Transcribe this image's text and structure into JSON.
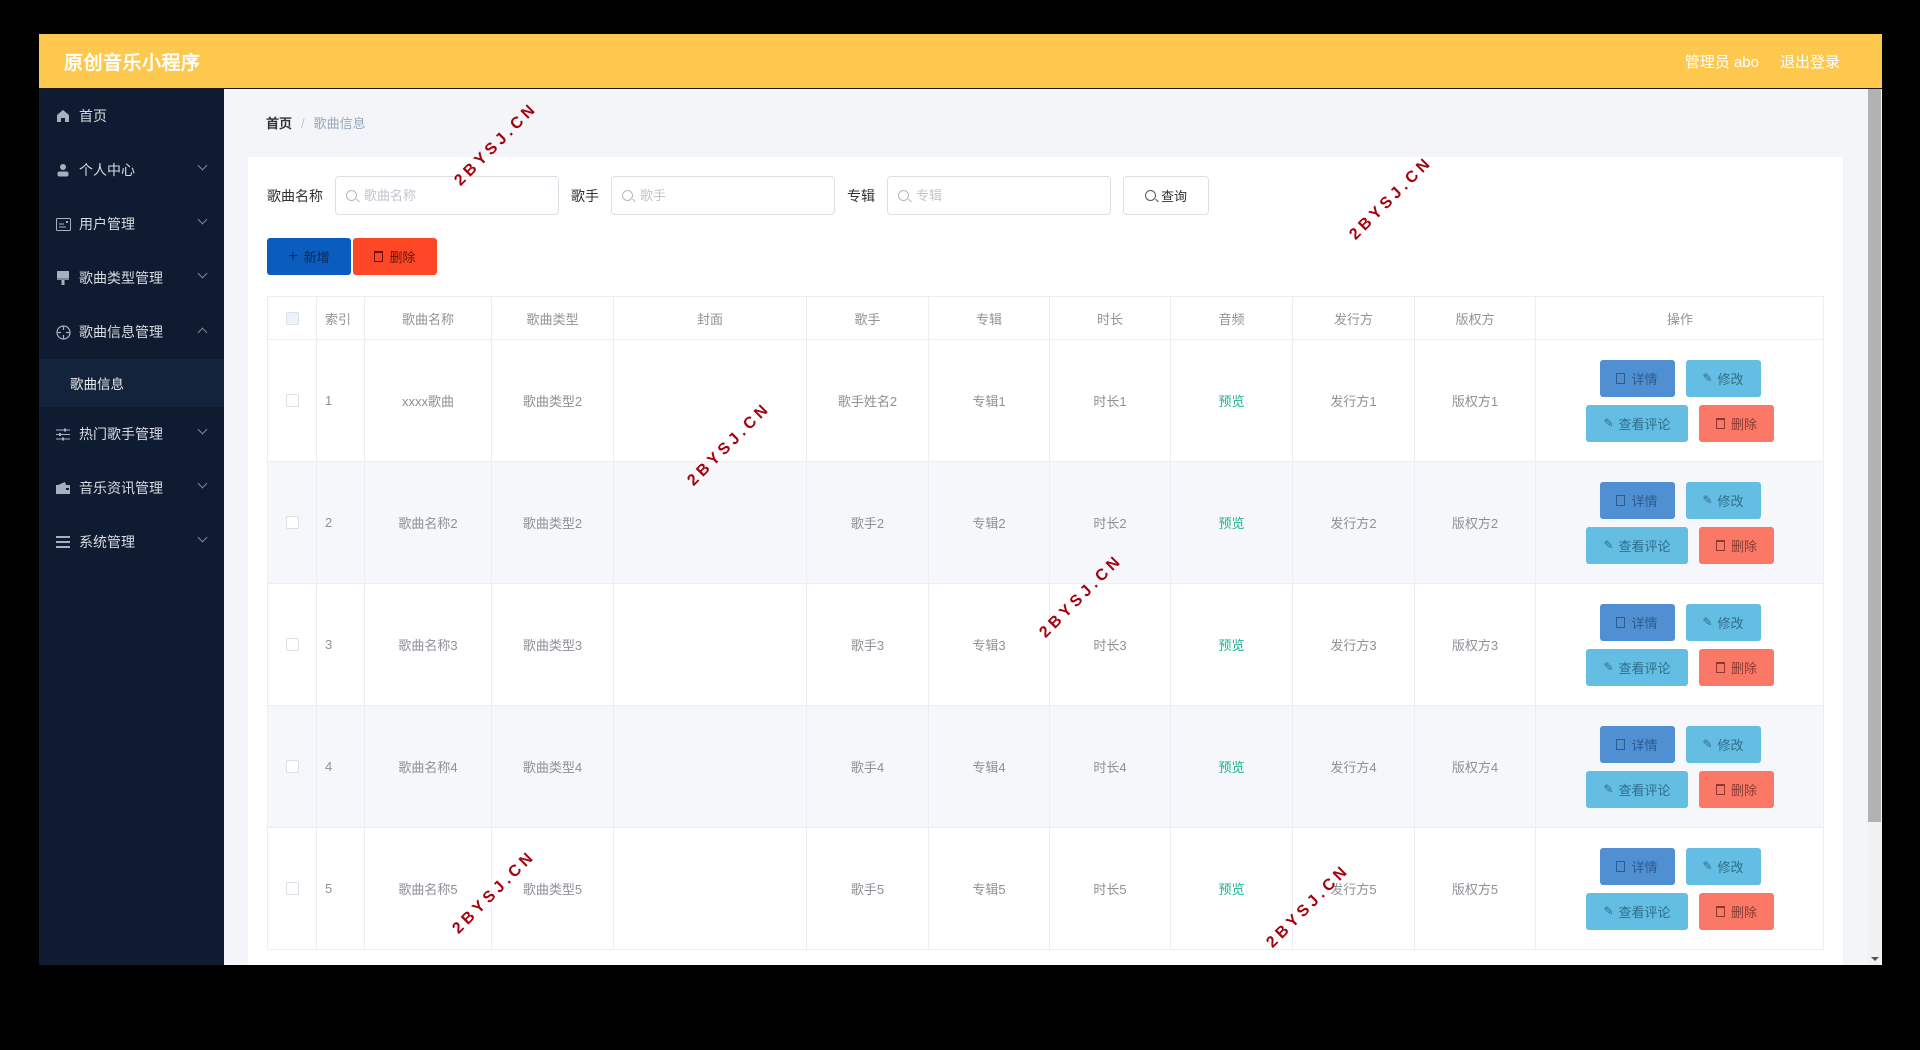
{
  "header": {
    "title": "原创音乐小程序",
    "user": "管理员 abo",
    "logout": "退出登录"
  },
  "sidebar": {
    "items": [
      {
        "label": "首页",
        "icon": "home-icon",
        "expandable": false
      },
      {
        "label": "个人中心",
        "icon": "user-icon",
        "expandable": true
      },
      {
        "label": "用户管理",
        "icon": "id-card-icon",
        "expandable": true
      },
      {
        "label": "歌曲类型管理",
        "icon": "brush-icon",
        "expandable": true
      },
      {
        "label": "歌曲信息管理",
        "icon": "target-icon",
        "expandable": true,
        "expanded": true
      },
      {
        "label": "热门歌手管理",
        "icon": "sliders-icon",
        "expandable": true
      },
      {
        "label": "音乐资讯管理",
        "icon": "wallet-icon",
        "expandable": true
      },
      {
        "label": "系统管理",
        "icon": "menu-icon",
        "expandable": true
      }
    ],
    "submenu_active": "歌曲信息"
  },
  "breadcrumb": {
    "home": "首页",
    "separator": "/",
    "current": "歌曲信息"
  },
  "search": {
    "fields": [
      {
        "label": "歌曲名称",
        "placeholder": "歌曲名称",
        "value": ""
      },
      {
        "label": "歌手",
        "placeholder": "歌手",
        "value": ""
      },
      {
        "label": "专辑",
        "placeholder": "专辑",
        "value": ""
      }
    ],
    "query_button": "查询"
  },
  "actions": {
    "add": "新增",
    "delete": "删除"
  },
  "table": {
    "columns": [
      "",
      "索引",
      "歌曲名称",
      "歌曲类型",
      "封面",
      "歌手",
      "专辑",
      "时长",
      "音频",
      "发行方",
      "版权方",
      "操作"
    ],
    "rows": [
      {
        "index": "1",
        "name": "xxxx歌曲",
        "type": "歌曲类型2",
        "cover": "",
        "singer": "歌手姓名2",
        "album": "专辑1",
        "duration": "时长1",
        "audio": "预览",
        "publisher": "发行方1",
        "copyright": "版权方1"
      },
      {
        "index": "2",
        "name": "歌曲名称2",
        "type": "歌曲类型2",
        "cover": "",
        "singer": "歌手2",
        "album": "专辑2",
        "duration": "时长2",
        "audio": "预览",
        "publisher": "发行方2",
        "copyright": "版权方2"
      },
      {
        "index": "3",
        "name": "歌曲名称3",
        "type": "歌曲类型3",
        "cover": "",
        "singer": "歌手3",
        "album": "专辑3",
        "duration": "时长3",
        "audio": "预览",
        "publisher": "发行方3",
        "copyright": "版权方3"
      },
      {
        "index": "4",
        "name": "歌曲名称4",
        "type": "歌曲类型4",
        "cover": "",
        "singer": "歌手4",
        "album": "专辑4",
        "duration": "时长4",
        "audio": "预览",
        "publisher": "发行方4",
        "copyright": "版权方4"
      },
      {
        "index": "5",
        "name": "歌曲名称5",
        "type": "歌曲类型5",
        "cover": "",
        "singer": "歌手5",
        "album": "专辑5",
        "duration": "时长5",
        "audio": "预览",
        "publisher": "发行方5",
        "copyright": "版权方5"
      }
    ],
    "row_actions": {
      "detail": "详情",
      "edit": "修改",
      "comments": "查看评论",
      "delete": "删除"
    }
  },
  "watermark": "2BYSJ.CN",
  "colors": {
    "header_bg": "#fec84e",
    "sidebar_bg": "#0f1b30",
    "add_button": "#0b5cbf",
    "delete_button": "#fd4726",
    "detail_button": "#4f8fd2",
    "edit_button": "#64bde2",
    "row_delete_button": "#fb7867",
    "preview_link": "#1ab394",
    "watermark": "#a5020d"
  }
}
